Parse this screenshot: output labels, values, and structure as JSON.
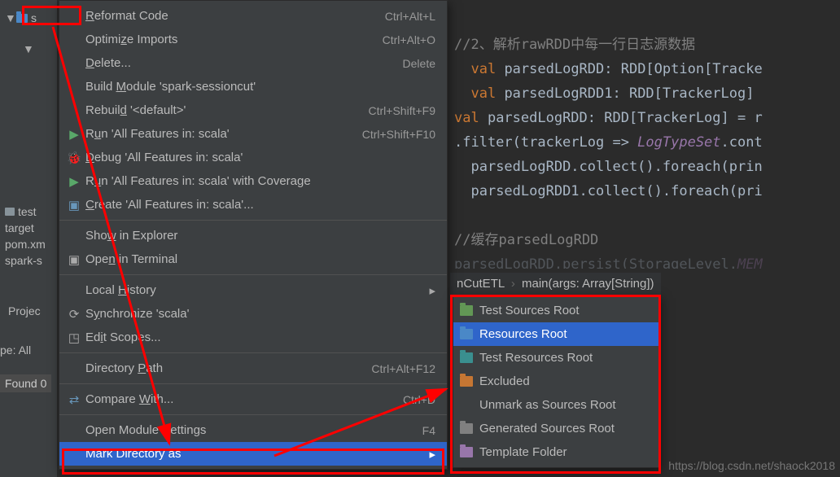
{
  "sidebar": {
    "top_folder": "s",
    "items": [
      "test",
      "target",
      "pom.xm",
      "spark-s"
    ],
    "project_label": "Projec",
    "pe_label": "pe:  All",
    "found_label": "Found 0"
  },
  "editor": {
    "l1": "//2、解析rawRDD中每一行日志源数据",
    "l2_kw": "val",
    "l2_id": " parsedLogRDD: RDD[Option[Tracke",
    "l3_kw": "val",
    "l3_id": " parsedLogRDD1: RDD[TrackerLog] ",
    "l4_kw": "val",
    "l4_id": " parsedLogRDD: RDD[TrackerLog] = r",
    "l5a": ".filter(trackerLog => ",
    "l5b": "LogTypeSet",
    "l5c": ".cont",
    "l6": "parsedLogRDD.collect().foreach(prin",
    "l7": "parsedLogRDD1.collect().foreach(pri",
    "l8": "//缓存parsedLogRDD",
    "l9a": "parsedLogRDD.persist(StorageLevel.",
    "l9b": "MEM"
  },
  "crumb": {
    "a": "nCutETL",
    "b": "main(args: Array[String])"
  },
  "menu": {
    "reformat": "Reformat Code",
    "reformat_sc": "Ctrl+Alt+L",
    "optimize": "Optimize Imports",
    "optimize_sc": "Ctrl+Alt+O",
    "delete": "Delete...",
    "delete_sc": "Delete",
    "build": "Build Module 'spark-sessioncut'",
    "rebuild": "Rebuild '<default>'",
    "rebuild_sc": "Ctrl+Shift+F9",
    "run": "Run 'All Features in: scala'",
    "run_sc": "Ctrl+Shift+F10",
    "debug": "Debug 'All Features in: scala'",
    "coverage": "Run 'All Features in: scala' with Coverage",
    "create": "Create 'All Features in: scala'...",
    "show": "Show in Explorer",
    "terminal": "Open in Terminal",
    "history": "Local History",
    "sync": "Synchronize 'scala'",
    "scopes": "Edit Scopes...",
    "dirpath": "Directory Path",
    "dirpath_sc": "Ctrl+Alt+F12",
    "compare": "Compare With...",
    "compare_sc": "Ctrl+D",
    "oms": "Open Module Settings",
    "oms_sc": "F4",
    "mark": "Mark Directory as"
  },
  "submenu": {
    "test_src": "Test Sources Root",
    "resources": "Resources Root",
    "test_res": "Test Resources Root",
    "excluded": "Excluded",
    "unmark": "Unmark as Sources Root",
    "generated": "Generated Sources Root",
    "template": "Template Folder"
  },
  "watermark": "https://blog.csdn.net/shaock2018"
}
